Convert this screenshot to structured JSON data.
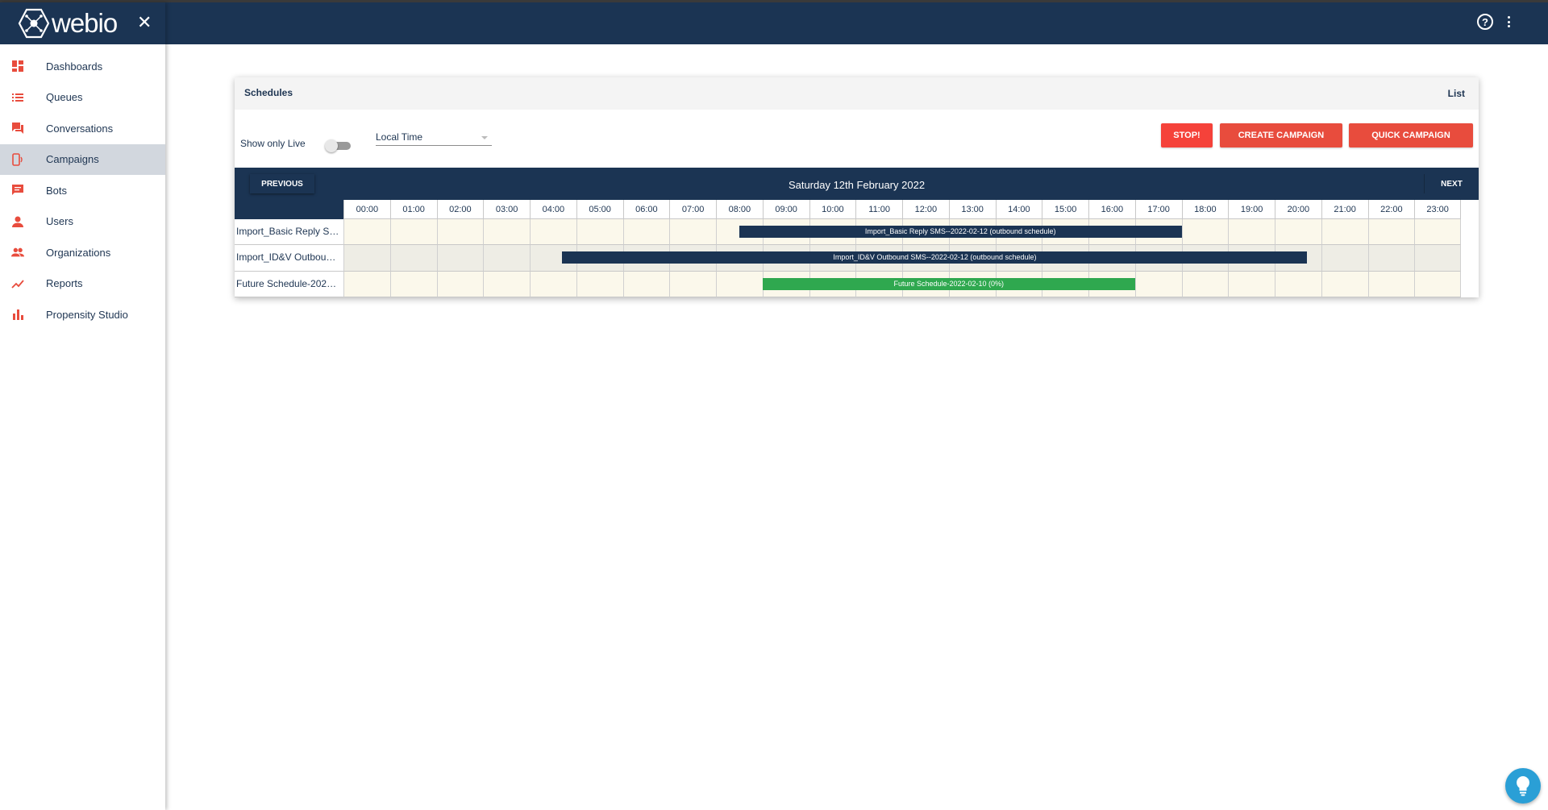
{
  "app": {
    "logo_text": "webio"
  },
  "sidebar": {
    "items": [
      {
        "label": "Dashboards",
        "icon": "dashboard-icon"
      },
      {
        "label": "Queues",
        "icon": "list-icon"
      },
      {
        "label": "Conversations",
        "icon": "forum-icon"
      },
      {
        "label": "Campaigns",
        "icon": "campaign-icon",
        "active": true
      },
      {
        "label": "Bots",
        "icon": "chat-icon"
      },
      {
        "label": "Users",
        "icon": "person-icon"
      },
      {
        "label": "Organizations",
        "icon": "people-icon"
      },
      {
        "label": "Reports",
        "icon": "trending-icon"
      },
      {
        "label": "Propensity Studio",
        "icon": "bar-chart-icon"
      }
    ]
  },
  "card": {
    "title": "Schedules",
    "list_label": "List",
    "show_live_label": "Show only Live",
    "show_live_on": false,
    "timezone_value": "Local Time",
    "stop_label": "STOP!",
    "create_label": "CREATE CAMPAIGN",
    "quick_label": "QUICK CAMPAIGN",
    "previous_label": "PREVIOUS",
    "next_label": "NEXT",
    "date_title": "Saturday 12th February 2022"
  },
  "timeline": {
    "hours": [
      "00:00",
      "01:00",
      "02:00",
      "03:00",
      "04:00",
      "05:00",
      "06:00",
      "07:00",
      "08:00",
      "09:00",
      "10:00",
      "11:00",
      "12:00",
      "13:00",
      "14:00",
      "15:00",
      "16:00",
      "17:00",
      "18:00",
      "19:00",
      "20:00",
      "21:00",
      "22:00",
      "23:00"
    ],
    "rows": [
      {
        "label": "Import_Basic Reply S…",
        "bar_label": "Import_Basic Reply SMS--2022-02-12 (outbound schedule)",
        "start_hour": 8.5,
        "end_hour": 18.0,
        "color": "#1b3453"
      },
      {
        "label": "Import_ID&V Outbou…",
        "bar_label": "Import_ID&V Outbound SMS--2022-02-12 (outbound schedule)",
        "start_hour": 4.7,
        "end_hour": 20.7,
        "color": "#1b3453"
      },
      {
        "label": "Future Schedule-202…",
        "bar_label": "Future Schedule-2022-02-10 (0%)",
        "start_hour": 9.0,
        "end_hour": 17.0,
        "color": "#2fa84f"
      }
    ]
  },
  "colors": {
    "navy": "#1b3453",
    "accent": "#e84c3d",
    "green": "#2fa84f"
  }
}
